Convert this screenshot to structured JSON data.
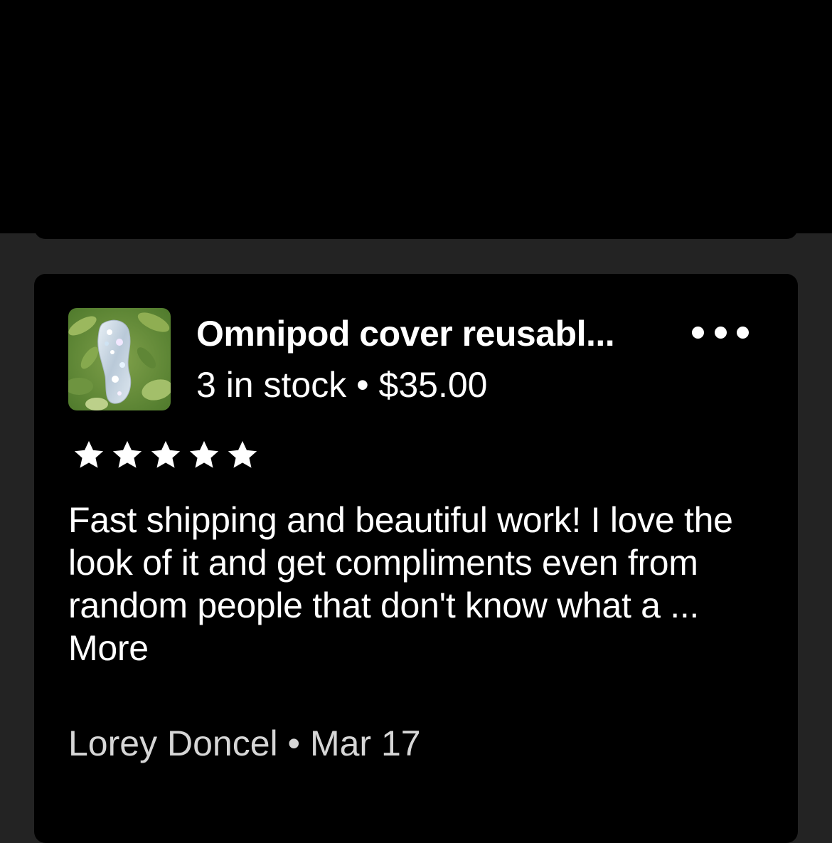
{
  "listing": {
    "title": "Omnipod cover reusabl...",
    "stock": "3 in stock",
    "separator": "•",
    "price": "$35.00",
    "thumbnail_icon": "product-thumbnail"
  },
  "menu": {
    "icon": "more-options-icon"
  },
  "review": {
    "rating": 5,
    "rating_max": 5,
    "text": "Fast shipping and beautiful work! I love the look of it and get compliments even from random people that don't know what a ...",
    "more_label": "More",
    "author": "Lorey Doncel",
    "separator": "•",
    "date": "Mar 17"
  },
  "colors": {
    "background": "#232323",
    "card": "#000000",
    "text": "#ffffff",
    "meta_text": "#d6d6d6"
  }
}
